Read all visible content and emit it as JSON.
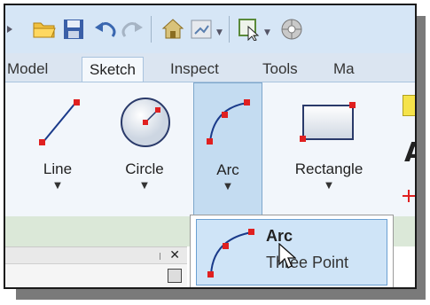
{
  "tabs": [
    {
      "label": "Model"
    },
    {
      "label": "Sketch"
    },
    {
      "label": "Inspect"
    },
    {
      "label": "Tools"
    },
    {
      "label": "Ma"
    }
  ],
  "tools": [
    {
      "label": "Line"
    },
    {
      "label": "Circle"
    },
    {
      "label": "Arc"
    },
    {
      "label": "Rectangle"
    }
  ],
  "dropdown": {
    "title": "Arc",
    "subtitle": "Three Point"
  },
  "icons": {
    "qat": [
      "menu-icon",
      "open-folder-icon",
      "save-icon",
      "undo-icon",
      "redo-icon",
      "home-icon",
      "return-icon",
      "select-icon",
      "appearance-icon"
    ]
  },
  "colors": {
    "accent": "#5b9bd5",
    "point_red": "#e02020",
    "ribbon_bg": "#f2f6fb"
  }
}
